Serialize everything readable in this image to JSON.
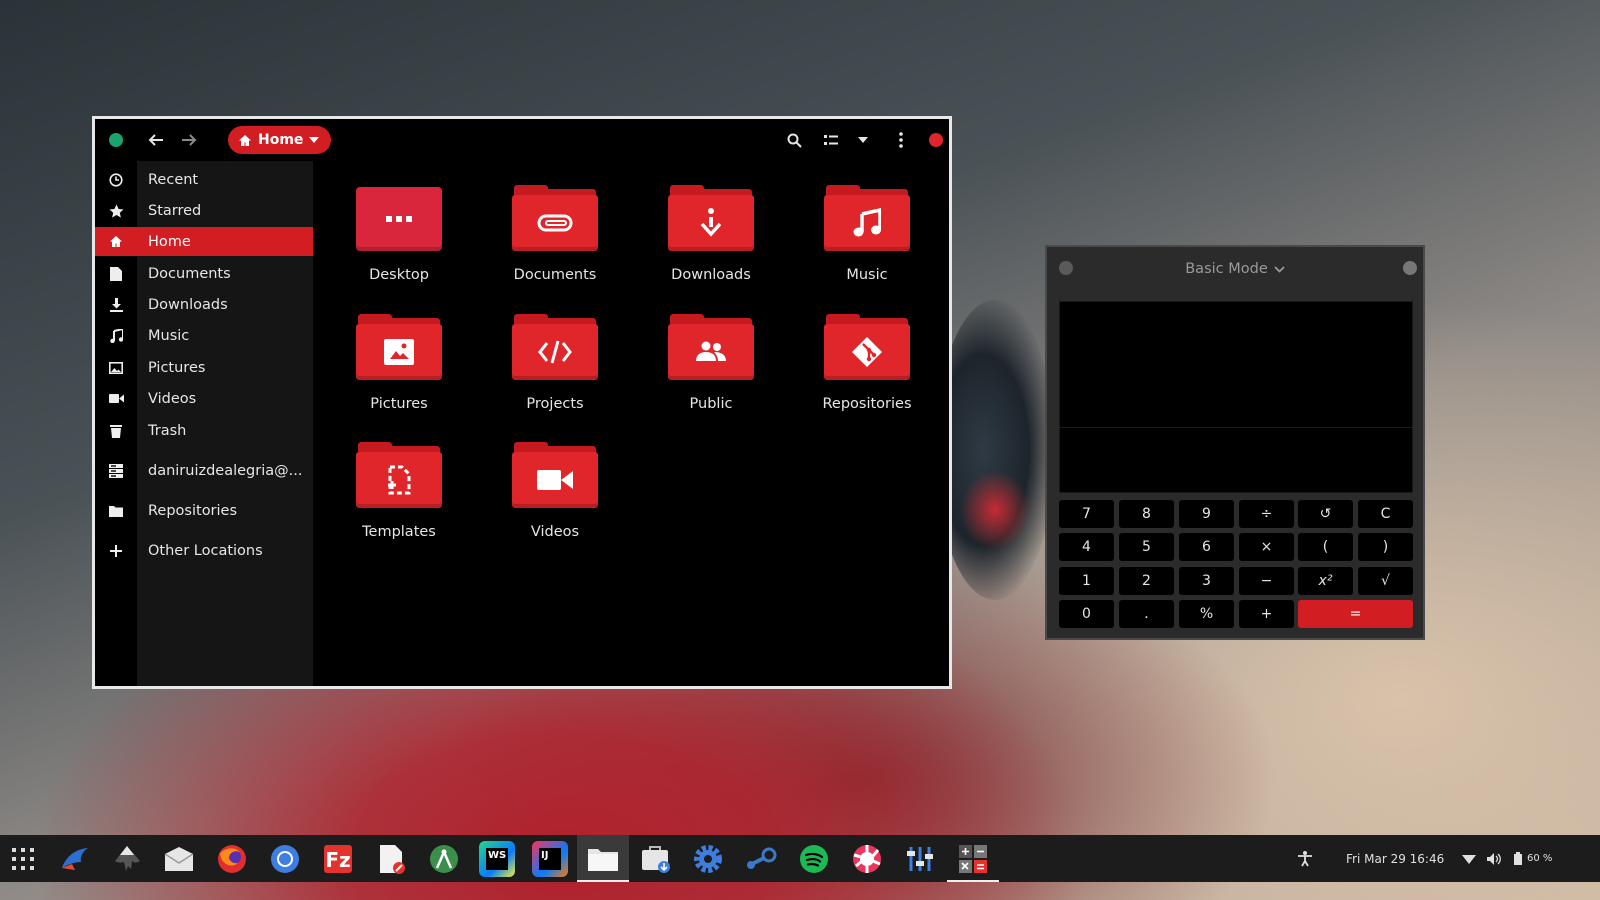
{
  "files": {
    "path_label": "Home",
    "sidebar": [
      {
        "label": "Recent",
        "icon": "clock-icon"
      },
      {
        "label": "Starred",
        "icon": "star-icon"
      },
      {
        "label": "Home",
        "icon": "home-icon",
        "active": true
      },
      {
        "label": "Documents",
        "icon": "document-icon"
      },
      {
        "label": "Downloads",
        "icon": "download-icon"
      },
      {
        "label": "Music",
        "icon": "music-icon"
      },
      {
        "label": "Pictures",
        "icon": "picture-icon"
      },
      {
        "label": "Videos",
        "icon": "video-icon"
      },
      {
        "label": "Trash",
        "icon": "trash-icon"
      },
      {
        "label": "daniruizdealegria@...",
        "icon": "server-icon"
      },
      {
        "label": "Repositories",
        "icon": "folder-icon"
      },
      {
        "label": "Other Locations",
        "icon": "plus-icon"
      }
    ],
    "folders": [
      {
        "label": "Desktop",
        "icon": "desktop-folder-icon"
      },
      {
        "label": "Documents",
        "icon": "documents-folder-icon"
      },
      {
        "label": "Downloads",
        "icon": "downloads-folder-icon"
      },
      {
        "label": "Music",
        "icon": "music-folder-icon"
      },
      {
        "label": "Pictures",
        "icon": "pictures-folder-icon"
      },
      {
        "label": "Projects",
        "icon": "projects-folder-icon"
      },
      {
        "label": "Public",
        "icon": "public-folder-icon"
      },
      {
        "label": "Repositories",
        "icon": "repositories-folder-icon"
      },
      {
        "label": "Templates",
        "icon": "templates-folder-icon"
      },
      {
        "label": "Videos",
        "icon": "videos-folder-icon"
      }
    ]
  },
  "calculator": {
    "mode_label": "Basic Mode",
    "keys": [
      "7",
      "8",
      "9",
      "÷",
      "↺",
      "C",
      "4",
      "5",
      "6",
      "×",
      "(",
      ")",
      "1",
      "2",
      "3",
      "−",
      "x²",
      "√",
      "0",
      ".",
      "%",
      "+",
      "="
    ]
  },
  "taskbar": {
    "clock": "Fri Mar 29  16:46",
    "battery": "60 %",
    "apps": [
      "app-grid-icon",
      "kingfisher-icon",
      "inkscape-icon",
      "mail-icon",
      "firefox-icon",
      "chromium-icon",
      "filezilla-icon",
      "text-editor-icon",
      "android-studio-icon",
      "webstorm-icon",
      "intellij-icon",
      "files-icon",
      "software-icon",
      "settings-icon",
      "steam-icon",
      "spotify-icon",
      "ubuntu-tweak-icon",
      "mixer-icon",
      "calculator-icon"
    ],
    "webstorm_label": "WS",
    "intellij_label": "IJ"
  },
  "colors": {
    "accent": "#d21e22",
    "window_bg": "#000000",
    "sidebar_bg": "#151515",
    "taskbar_bg": "#1c1c1c"
  }
}
